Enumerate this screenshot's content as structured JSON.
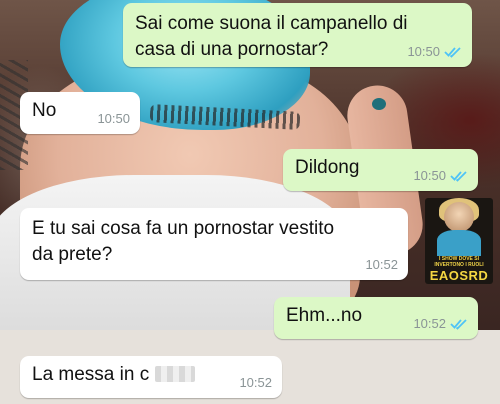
{
  "messages": [
    {
      "side": "out",
      "text": "Sai come suona il campanello di\ncasa di una pornostar?",
      "time": "10:50",
      "read": true
    },
    {
      "side": "in",
      "text": "No",
      "time": "10:50",
      "read": false
    },
    {
      "side": "out",
      "text": "Dildong",
      "time": "10:50",
      "read": true
    },
    {
      "side": "in",
      "text": "E tu sai cosa fa un pornostar vestito\nda prete?",
      "time": "10:52",
      "read": false
    },
    {
      "side": "out",
      "text": "Ehm...no",
      "time": "10:52",
      "read": true
    },
    {
      "side": "in",
      "text": "La messa in c",
      "time": "10:52",
      "read": false,
      "censored": true
    }
  ],
  "watermark": {
    "small_text": "I SHOW DOVE SI INVERTONO I RUOLI",
    "title": "EAOSRD"
  },
  "colors": {
    "outgoing_bubble": "#dcf8c6",
    "incoming_bubble": "#ffffff",
    "read_ticks": "#4fc3f7",
    "time_text": "#8a9496"
  }
}
